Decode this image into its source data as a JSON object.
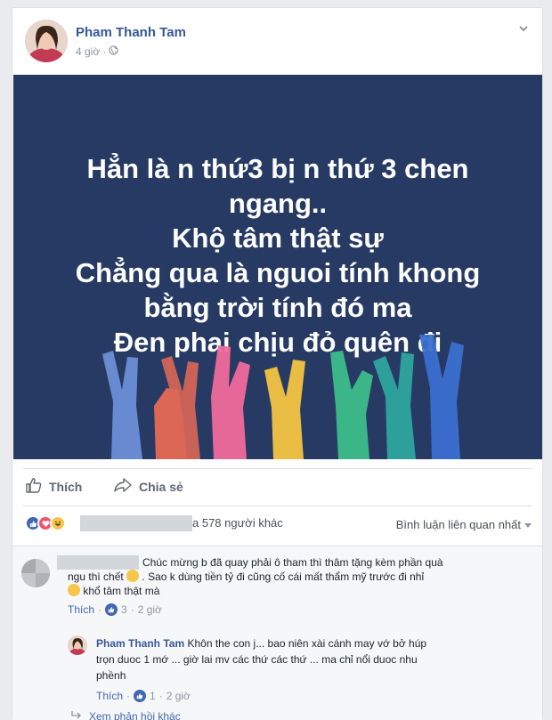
{
  "post": {
    "author": "Pham Thanh Tam",
    "time": "4 giờ",
    "privacy_icon": "globe-icon",
    "banner_lines": [
      "Hẳn là n thứ3 bị n thứ 3 chen",
      "ngang..",
      "Khộ tâm thật sự",
      "Chẳng qua là nguoi tính khong",
      "bằng trời tính đó ma",
      "Đen phai chịu đỏ quên đi"
    ],
    "colors": {
      "banner_bg": "#263a64",
      "link": "#365899",
      "like_blue": "#4267b2"
    }
  },
  "actions": {
    "like_label": "Thích",
    "share_label": "Chia sẻ"
  },
  "reactions": {
    "types": [
      "like",
      "love",
      "haha"
    ],
    "count_text": "a 578 người khác",
    "sort_label": "Bình luận liên quan nhất"
  },
  "comments": [
    {
      "line1": "Chúc mừng b đã quay phải ô tham thì thâm tặng kèm phần quà",
      "line2a": "ngu thì chết",
      "line2b": ". Sao k dùng tiền tỷ đi cũng cố cái mất thẩm mỹ trước đi nhỉ",
      "line3": "khổ tâm thật mà",
      "like_label": "Thích",
      "like_count": "3",
      "time": "2 giờ"
    }
  ],
  "reply": {
    "author": "Pham Thanh Tam",
    "line1": "Khôn the con j... bao niên xài cánh may vớ bở húp",
    "line2": "trọn duoc 1 mớ ... giờ lai mv các thứ các thứ ... ma chỉ nổi duoc nhu",
    "line3": "phềnh",
    "like_label": "Thích",
    "like_count": "1",
    "time": "2 giờ"
  },
  "more_replies": "Xem phản hồi khác"
}
